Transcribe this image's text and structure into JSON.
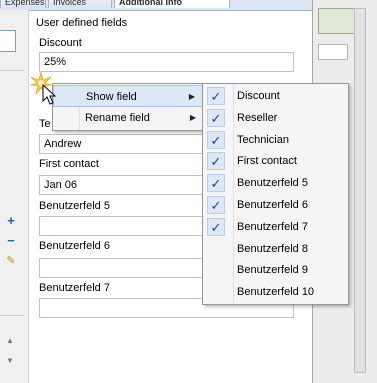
{
  "tabs": [
    {
      "label": "Expenses"
    },
    {
      "label": "Invoices"
    },
    {
      "label": "Additional Info"
    }
  ],
  "group": {
    "title": "User defined fields"
  },
  "fields": [
    {
      "label": "Discount",
      "value": "25%"
    },
    {
      "label": "",
      "value": ""
    },
    {
      "label": "",
      "value": "Andrew"
    },
    {
      "label": "First contact",
      "value": "Jan 06"
    },
    {
      "label": "Benutzerfeld 5",
      "value": ""
    },
    {
      "label": "Benutzerfeld 6",
      "value": ""
    },
    {
      "label": "Benutzerfeld 7",
      "value": ""
    }
  ],
  "partial_labels": {
    "te": "Te"
  },
  "context_menu": {
    "items": [
      {
        "label": "Show field",
        "has_submenu": true
      },
      {
        "label": "Rename field",
        "has_submenu": true
      }
    ]
  },
  "submenu": {
    "items": [
      {
        "label": "Discount",
        "checked": true
      },
      {
        "label": "Reseller",
        "checked": true
      },
      {
        "label": "Technician",
        "checked": true
      },
      {
        "label": "First contact",
        "checked": true
      },
      {
        "label": "Benutzerfeld 5",
        "checked": true
      },
      {
        "label": "Benutzerfeld 6",
        "checked": true
      },
      {
        "label": "Benutzerfeld 7",
        "checked": true
      },
      {
        "label": "Benutzerfeld 8",
        "checked": false
      },
      {
        "label": "Benutzerfeld 9",
        "checked": false
      },
      {
        "label": "Benutzerfeld 10",
        "checked": false
      }
    ]
  },
  "icons": {
    "check": "check-mark-icon",
    "submenu_arrow": "chevron-right-icon",
    "add": "plus-icon",
    "remove": "minus-icon",
    "edit": "pencil-icon",
    "cursor": "mouse-pointer-icon",
    "click_burst": "click-burst-icon"
  },
  "colors": {
    "check": "#1b3fa6",
    "highlight": "#dbe8f8",
    "field_border": "#b9c5d3"
  }
}
